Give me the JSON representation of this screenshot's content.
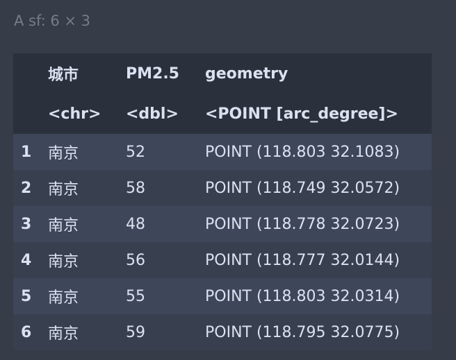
{
  "caption": "A sf: 6 × 3",
  "columns": [
    {
      "name": "城市",
      "type": "<chr>"
    },
    {
      "name": "PM2.5",
      "type": "<dbl>"
    },
    {
      "name": "geometry",
      "type": "<POINT [arc_degree]>"
    }
  ],
  "rows": [
    {
      "index": "1",
      "city": "南京",
      "pm25": "52",
      "geometry": "POINT (118.803 32.1083)"
    },
    {
      "index": "2",
      "city": "南京",
      "pm25": "58",
      "geometry": "POINT (118.749 32.0572)"
    },
    {
      "index": "3",
      "city": "南京",
      "pm25": "48",
      "geometry": "POINT (118.778 32.0723)"
    },
    {
      "index": "4",
      "city": "南京",
      "pm25": "56",
      "geometry": "POINT (118.777 32.0144)"
    },
    {
      "index": "5",
      "city": "南京",
      "pm25": "55",
      "geometry": "POINT (118.803 32.0314)"
    },
    {
      "index": "6",
      "city": "南京",
      "pm25": "59",
      "geometry": "POINT (118.795 32.0775)"
    }
  ]
}
